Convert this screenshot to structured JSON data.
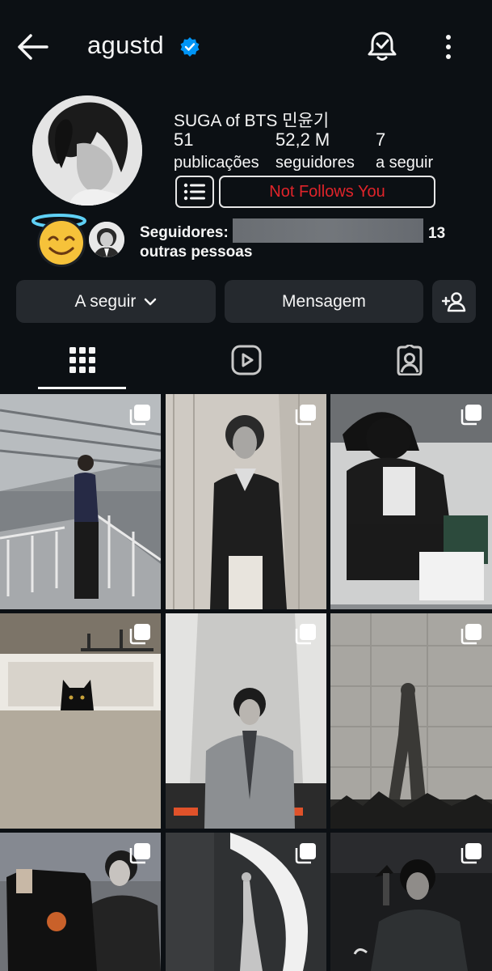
{
  "header": {
    "username": "agustd"
  },
  "profile": {
    "full_name": "SUGA of BTS 민윤기",
    "stats": [
      {
        "value": "51",
        "label": "publicações"
      },
      {
        "value": "52,2 M",
        "label": "seguidores"
      },
      {
        "value": "7",
        "label": "a seguir"
      }
    ],
    "follow_status": "Not Follows You"
  },
  "followed_by": {
    "prefix": "Seguidores:",
    "count": "13",
    "suffix": "outras pessoas"
  },
  "actions": {
    "following_label": "A seguir",
    "message_label": "Mensagem"
  },
  "tabs": [
    {
      "icon": "grid-icon",
      "selected": true
    },
    {
      "icon": "reels-icon",
      "selected": false
    },
    {
      "icon": "tagged-icon",
      "selected": false
    }
  ],
  "colors": {
    "background": "#0c1014",
    "button": "#25292e",
    "verified": "#0095f6",
    "not_follows": "#e0242a"
  }
}
